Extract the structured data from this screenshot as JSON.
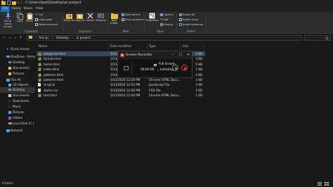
{
  "window": {
    "path": "C:\\Users\\test\\Desktop\\ai project"
  },
  "tabs": [
    {
      "label": "File"
    },
    {
      "label": "Home"
    },
    {
      "label": "Share"
    },
    {
      "label": "View"
    }
  ],
  "ribbon": {
    "clipboard": {
      "pin": "Pin to Quick access",
      "copy": "Copy",
      "paste": "Paste",
      "cut": "Cut",
      "copy_path": "Copy path",
      "paste_shortcut": "Paste shortcut",
      "label": "Clipboard"
    },
    "organize": {
      "move_to": "Move to",
      "copy_to": "Copy to",
      "delete": "Delete",
      "rename": "Rename",
      "label": "Organize"
    },
    "new": {
      "new_folder": "New folder",
      "new_item": "New item ▾",
      "easy_access": "Easy access ▾",
      "label": "New"
    },
    "open": {
      "properties": "Properties",
      "open": "Open ▾",
      "edit": "Edit",
      "history": "History",
      "label": "Open"
    },
    "select": {
      "select_all": "Select all",
      "select_none": "Select none",
      "invert": "Invert selection",
      "label": "Select"
    }
  },
  "address": {
    "segments": [
      "this pc",
      "Desktop",
      "ai project"
    ]
  },
  "nav": {
    "items": [
      {
        "label": "Quick access"
      },
      {
        "label": "OneDrive - Perso"
      },
      {
        "label": "Desktop"
      },
      {
        "label": "Documents"
      },
      {
        "label": "Pictures"
      },
      {
        "label": "This PC"
      },
      {
        "label": "3D Objects"
      },
      {
        "label": "Desktop"
      },
      {
        "label": "Documents"
      },
      {
        "label": "Downloads"
      },
      {
        "label": "Music"
      },
      {
        "label": "Pictures"
      },
      {
        "label": "Videos"
      },
      {
        "label": "Local Disk (C:)"
      },
      {
        "label": "Network"
      }
    ]
  },
  "columns": {
    "name": "Name",
    "date": "Date modified",
    "type": "Type",
    "size": "Size"
  },
  "files": [
    {
      "name": "aiexpress.html",
      "date": "5/13/",
      "type": "",
      "size": "4 KB",
      "icon": "chrome",
      "selected": true
    },
    {
      "name": "format.html",
      "date": "5/13/",
      "type": "",
      "size": "3 KB",
      "icon": "chrome"
    },
    {
      "name": "home.html",
      "date": "5/13/",
      "type": "",
      "size": "5 KB",
      "icon": "chrome"
    },
    {
      "name": "index.html",
      "date": "5/13/",
      "type": "",
      "size": "1 KB",
      "icon": "chrome"
    },
    {
      "name": "patterns.html",
      "date": "5/13/",
      "type": "",
      "size": "4 KB",
      "icon": "chrome"
    },
    {
      "name": "patterns.html",
      "date": "5/12/2024 12:28 PM",
      "type": "Chrome HTML Docu...",
      "size": "3 KB",
      "icon": "chrome"
    },
    {
      "name": "script.js",
      "date": "5/13/2024 12:52 PM",
      "type": "JavaScript File",
      "size": "2 KB",
      "icon": "js"
    },
    {
      "name": "styles.css",
      "date": "5/13/2024 12:28 PM",
      "type": "CSS File",
      "size": "3 KB",
      "icon": "css"
    },
    {
      "name": "test.html",
      "date": "5/13/2024 12:40 PM",
      "type": "Chrome HTML Docu...",
      "size": "1 KB",
      "icon": "chrome"
    }
  ],
  "recorder": {
    "title": "Screen Recorder",
    "mode": "Full Screen",
    "time": "00:00:00",
    "status": "Initiating"
  },
  "status": {
    "items": "9 items"
  },
  "colors": {
    "accent": "#1a6fc4",
    "selection": "#35455a",
    "record": "#e03a3a",
    "folder": "#e8b84a",
    "chrome_red": "#db4437",
    "chrome_yellow": "#f4b400",
    "chrome_green": "#0f9d58",
    "chrome_blue": "#4285f4"
  }
}
